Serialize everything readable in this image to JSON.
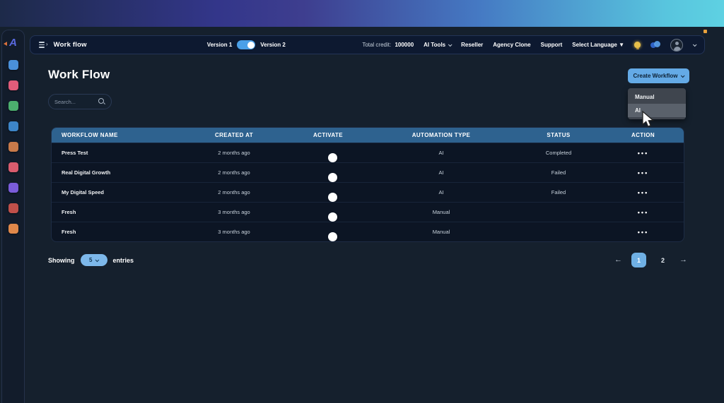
{
  "colors": {
    "accent_blue": "#64aae6",
    "table_header_blue": "#2e628f",
    "gradient_left": "#1d2a49",
    "gradient_purple": "#3e3e8f",
    "gradient_blue": "#4579c3",
    "gradient_cyan": "#58c5de"
  },
  "sidebar": {
    "icons": [
      {
        "name": "app-blue",
        "color": "#4a90d9"
      },
      {
        "name": "app-pink",
        "color": "#e05c7a"
      },
      {
        "name": "app-green",
        "color": "#4caf6e"
      },
      {
        "name": "app-skyblue",
        "color": "#3d85c8"
      },
      {
        "name": "app-orange-brown",
        "color": "#c87a4a"
      },
      {
        "name": "app-red",
        "color": "#d95c6e"
      },
      {
        "name": "app-purple",
        "color": "#7a5cd9"
      },
      {
        "name": "app-rust",
        "color": "#c0504a"
      },
      {
        "name": "app-amber",
        "color": "#e0884a"
      }
    ]
  },
  "navbar": {
    "title": "Work flow",
    "version_left": "Version 1",
    "version_right": "Version 2",
    "credit_label": "Total credit:",
    "credit_value": "100000",
    "links": [
      {
        "label": "AI Tools",
        "chevron": true
      },
      {
        "label": "Reseller",
        "chevron": false
      },
      {
        "label": "Agency Clone",
        "chevron": false
      },
      {
        "label": "Support",
        "chevron": false
      },
      {
        "label": "Select Language ▼",
        "chevron": false
      }
    ]
  },
  "main": {
    "title": "Work Flow",
    "search_placeholder": "Search...",
    "create_button_label": "Create Workflow",
    "dropdown_items": [
      {
        "label": "Manual",
        "highlighted": false
      },
      {
        "label": "AI",
        "highlighted": true
      }
    ]
  },
  "table": {
    "columns": [
      "WORKFLOW NAME",
      "CREATED AT",
      "ACTIVATE",
      "AUTOMATION TYPE",
      "STATUS",
      "ACTION"
    ],
    "action_glyph": "•••",
    "rows": [
      {
        "name": "Press Test",
        "created": "2 months ago",
        "type": "AI",
        "status": "Completed"
      },
      {
        "name": "Real Digital Growth",
        "created": "2 months ago",
        "type": "AI",
        "status": "Failed"
      },
      {
        "name": "My Digital Speed",
        "created": "2 months ago",
        "type": "AI",
        "status": "Failed"
      },
      {
        "name": "Fresh",
        "created": "3 months ago",
        "type": "Manual",
        "status": ""
      },
      {
        "name": "Fresh",
        "created": "3 months ago",
        "type": "Manual",
        "status": ""
      }
    ]
  },
  "pagination": {
    "showing_label": "Showing",
    "page_size": "5",
    "entries_label": "entries",
    "prev": "←",
    "next": "→",
    "pages": [
      "1",
      "2"
    ],
    "active": "1"
  }
}
